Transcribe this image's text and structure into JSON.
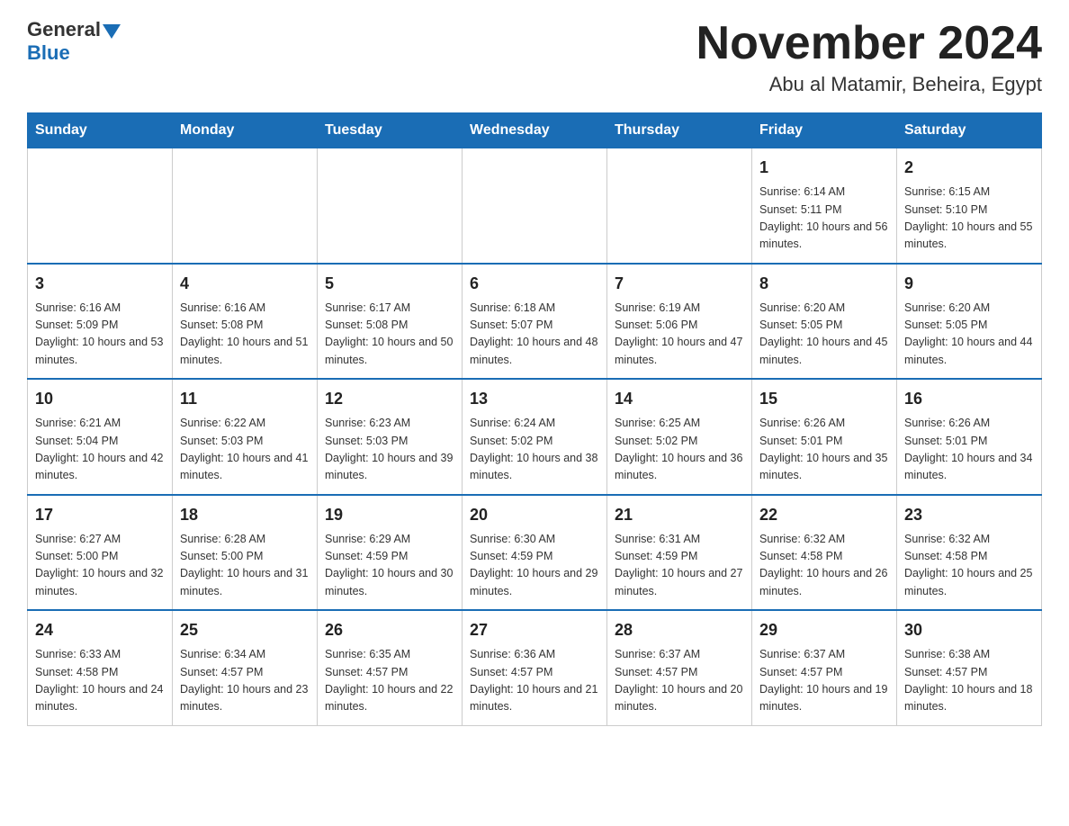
{
  "header": {
    "logo_text1": "General",
    "logo_text2": "Blue",
    "month_title": "November 2024",
    "location": "Abu al Matamir, Beheira, Egypt"
  },
  "weekdays": [
    "Sunday",
    "Monday",
    "Tuesday",
    "Wednesday",
    "Thursday",
    "Friday",
    "Saturday"
  ],
  "weeks": [
    [
      {
        "day": "",
        "info": ""
      },
      {
        "day": "",
        "info": ""
      },
      {
        "day": "",
        "info": ""
      },
      {
        "day": "",
        "info": ""
      },
      {
        "day": "",
        "info": ""
      },
      {
        "day": "1",
        "info": "Sunrise: 6:14 AM\nSunset: 5:11 PM\nDaylight: 10 hours and 56 minutes."
      },
      {
        "day": "2",
        "info": "Sunrise: 6:15 AM\nSunset: 5:10 PM\nDaylight: 10 hours and 55 minutes."
      }
    ],
    [
      {
        "day": "3",
        "info": "Sunrise: 6:16 AM\nSunset: 5:09 PM\nDaylight: 10 hours and 53 minutes."
      },
      {
        "day": "4",
        "info": "Sunrise: 6:16 AM\nSunset: 5:08 PM\nDaylight: 10 hours and 51 minutes."
      },
      {
        "day": "5",
        "info": "Sunrise: 6:17 AM\nSunset: 5:08 PM\nDaylight: 10 hours and 50 minutes."
      },
      {
        "day": "6",
        "info": "Sunrise: 6:18 AM\nSunset: 5:07 PM\nDaylight: 10 hours and 48 minutes."
      },
      {
        "day": "7",
        "info": "Sunrise: 6:19 AM\nSunset: 5:06 PM\nDaylight: 10 hours and 47 minutes."
      },
      {
        "day": "8",
        "info": "Sunrise: 6:20 AM\nSunset: 5:05 PM\nDaylight: 10 hours and 45 minutes."
      },
      {
        "day": "9",
        "info": "Sunrise: 6:20 AM\nSunset: 5:05 PM\nDaylight: 10 hours and 44 minutes."
      }
    ],
    [
      {
        "day": "10",
        "info": "Sunrise: 6:21 AM\nSunset: 5:04 PM\nDaylight: 10 hours and 42 minutes."
      },
      {
        "day": "11",
        "info": "Sunrise: 6:22 AM\nSunset: 5:03 PM\nDaylight: 10 hours and 41 minutes."
      },
      {
        "day": "12",
        "info": "Sunrise: 6:23 AM\nSunset: 5:03 PM\nDaylight: 10 hours and 39 minutes."
      },
      {
        "day": "13",
        "info": "Sunrise: 6:24 AM\nSunset: 5:02 PM\nDaylight: 10 hours and 38 minutes."
      },
      {
        "day": "14",
        "info": "Sunrise: 6:25 AM\nSunset: 5:02 PM\nDaylight: 10 hours and 36 minutes."
      },
      {
        "day": "15",
        "info": "Sunrise: 6:26 AM\nSunset: 5:01 PM\nDaylight: 10 hours and 35 minutes."
      },
      {
        "day": "16",
        "info": "Sunrise: 6:26 AM\nSunset: 5:01 PM\nDaylight: 10 hours and 34 minutes."
      }
    ],
    [
      {
        "day": "17",
        "info": "Sunrise: 6:27 AM\nSunset: 5:00 PM\nDaylight: 10 hours and 32 minutes."
      },
      {
        "day": "18",
        "info": "Sunrise: 6:28 AM\nSunset: 5:00 PM\nDaylight: 10 hours and 31 minutes."
      },
      {
        "day": "19",
        "info": "Sunrise: 6:29 AM\nSunset: 4:59 PM\nDaylight: 10 hours and 30 minutes."
      },
      {
        "day": "20",
        "info": "Sunrise: 6:30 AM\nSunset: 4:59 PM\nDaylight: 10 hours and 29 minutes."
      },
      {
        "day": "21",
        "info": "Sunrise: 6:31 AM\nSunset: 4:59 PM\nDaylight: 10 hours and 27 minutes."
      },
      {
        "day": "22",
        "info": "Sunrise: 6:32 AM\nSunset: 4:58 PM\nDaylight: 10 hours and 26 minutes."
      },
      {
        "day": "23",
        "info": "Sunrise: 6:32 AM\nSunset: 4:58 PM\nDaylight: 10 hours and 25 minutes."
      }
    ],
    [
      {
        "day": "24",
        "info": "Sunrise: 6:33 AM\nSunset: 4:58 PM\nDaylight: 10 hours and 24 minutes."
      },
      {
        "day": "25",
        "info": "Sunrise: 6:34 AM\nSunset: 4:57 PM\nDaylight: 10 hours and 23 minutes."
      },
      {
        "day": "26",
        "info": "Sunrise: 6:35 AM\nSunset: 4:57 PM\nDaylight: 10 hours and 22 minutes."
      },
      {
        "day": "27",
        "info": "Sunrise: 6:36 AM\nSunset: 4:57 PM\nDaylight: 10 hours and 21 minutes."
      },
      {
        "day": "28",
        "info": "Sunrise: 6:37 AM\nSunset: 4:57 PM\nDaylight: 10 hours and 20 minutes."
      },
      {
        "day": "29",
        "info": "Sunrise: 6:37 AM\nSunset: 4:57 PM\nDaylight: 10 hours and 19 minutes."
      },
      {
        "day": "30",
        "info": "Sunrise: 6:38 AM\nSunset: 4:57 PM\nDaylight: 10 hours and 18 minutes."
      }
    ]
  ]
}
